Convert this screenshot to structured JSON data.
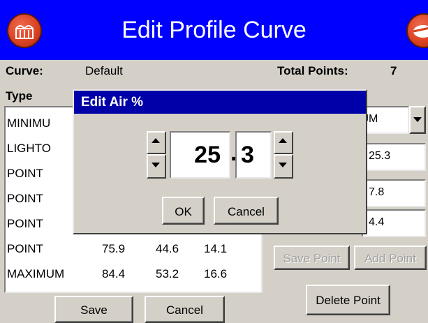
{
  "header": {
    "title": "Edit Profile Curve",
    "left_icon": "building-icon",
    "right_icon": "exit-icon",
    "color": "#0000ff"
  },
  "info": {
    "curve_label": "Curve:",
    "curve_value": "Default",
    "total_label": "Total Points:",
    "total_value": "7"
  },
  "list": {
    "type_header": "Type",
    "rows": [
      {
        "type": "MINIMU",
        "a": "",
        "b": "",
        "c": ""
      },
      {
        "type": "LIGHTO",
        "a": "",
        "b": "",
        "c": ""
      },
      {
        "type": "POINT",
        "a": "",
        "b": "",
        "c": ""
      },
      {
        "type": "POINT",
        "a": "",
        "b": "",
        "c": ""
      },
      {
        "type": "POINT",
        "a": "",
        "b": "",
        "c": ""
      },
      {
        "type": "POINT",
        "a": "75.9",
        "b": "44.6",
        "c": "14.1"
      },
      {
        "type": "MAXIMUM",
        "a": "84.4",
        "b": "53.2",
        "c": "16.6"
      }
    ]
  },
  "right": {
    "type_select_value": "JM",
    "field1": "25.3",
    "field2": "7.8",
    "field3": "4.4",
    "save_point": "Save Point",
    "add_point": "Add Point",
    "delete_point": "Delete Point"
  },
  "footer": {
    "save": "Save",
    "cancel": "Cancel"
  },
  "dialog": {
    "title": "Edit Air %",
    "integer": "25",
    "separator": ".",
    "decimal": "3",
    "ok": "OK",
    "cancel": "Cancel",
    "title_color": "#0000a8"
  }
}
